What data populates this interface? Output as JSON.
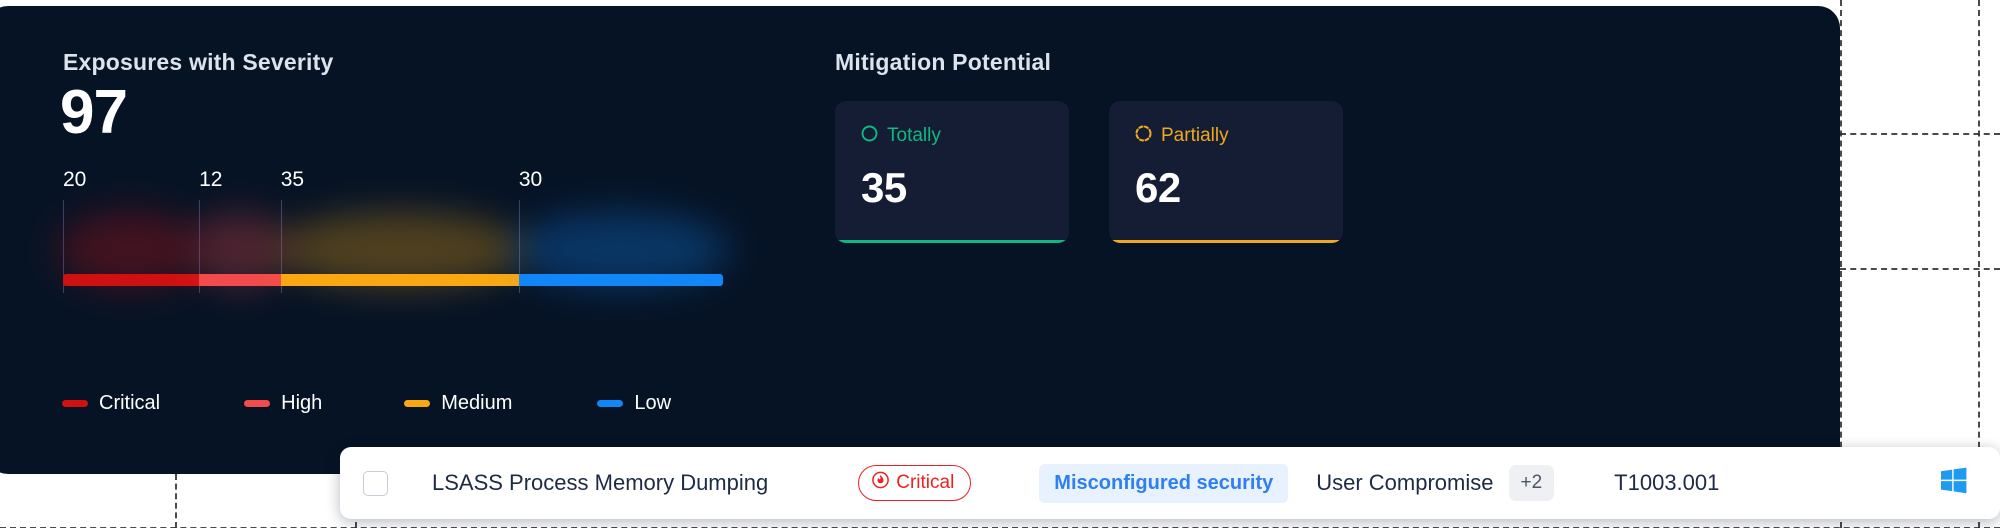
{
  "panel": {
    "background_color": "#061325"
  },
  "exposures": {
    "title": "Exposures with Severity",
    "total": "97",
    "ticks": [
      {
        "label": "20",
        "severity": "Critical"
      },
      {
        "label": "12",
        "severity": "High"
      },
      {
        "label": "35",
        "severity": "Medium"
      },
      {
        "label": "30",
        "severity": "Low"
      }
    ],
    "legend": [
      {
        "label": "Critical",
        "color": "#cf1111"
      },
      {
        "label": "High",
        "color": "#f24b4b"
      },
      {
        "label": "Medium",
        "color": "#f9a813"
      },
      {
        "label": "Low",
        "color": "#1186f7"
      }
    ]
  },
  "mitigation": {
    "title": "Mitigation Potential",
    "cards": [
      {
        "label": "Totally",
        "value": "35",
        "color": "#10b981",
        "icon": "circle-outline-icon"
      },
      {
        "label": "Partially",
        "value": "62",
        "color": "#f0a91e",
        "icon": "circle-dashed-icon"
      }
    ]
  },
  "exposure_row": {
    "checkbox_checked": "false",
    "title": "LSASS Process Memory Dumping",
    "severity": {
      "label": "Critical",
      "color": "#ef2020",
      "icon": "fire-icon"
    },
    "category_tag": "Misconfigured security",
    "impact": "User Compromise",
    "impact_more": "+2",
    "technique_id": "T1003.001",
    "platform_icon": "windows-icon",
    "platform_icon_color": "#1e9bf0"
  },
  "chart_data": {
    "type": "bar",
    "title": "Exposures with Severity",
    "orientation": "horizontal-stacked",
    "total": 97,
    "categories": [
      "Critical",
      "High",
      "Medium",
      "Low"
    ],
    "values": [
      20,
      12,
      35,
      30
    ],
    "colors": [
      "#cf1111",
      "#f24b4b",
      "#f9a813",
      "#1186f7"
    ],
    "tick_labels": [
      "20",
      "12",
      "35",
      "30"
    ],
    "legend_entries": [
      "Critical",
      "High",
      "Medium",
      "Low"
    ],
    "legend_position": "bottom-left",
    "grid": false,
    "xlabel": "",
    "ylabel": "",
    "annotations": [
      "97"
    ]
  }
}
